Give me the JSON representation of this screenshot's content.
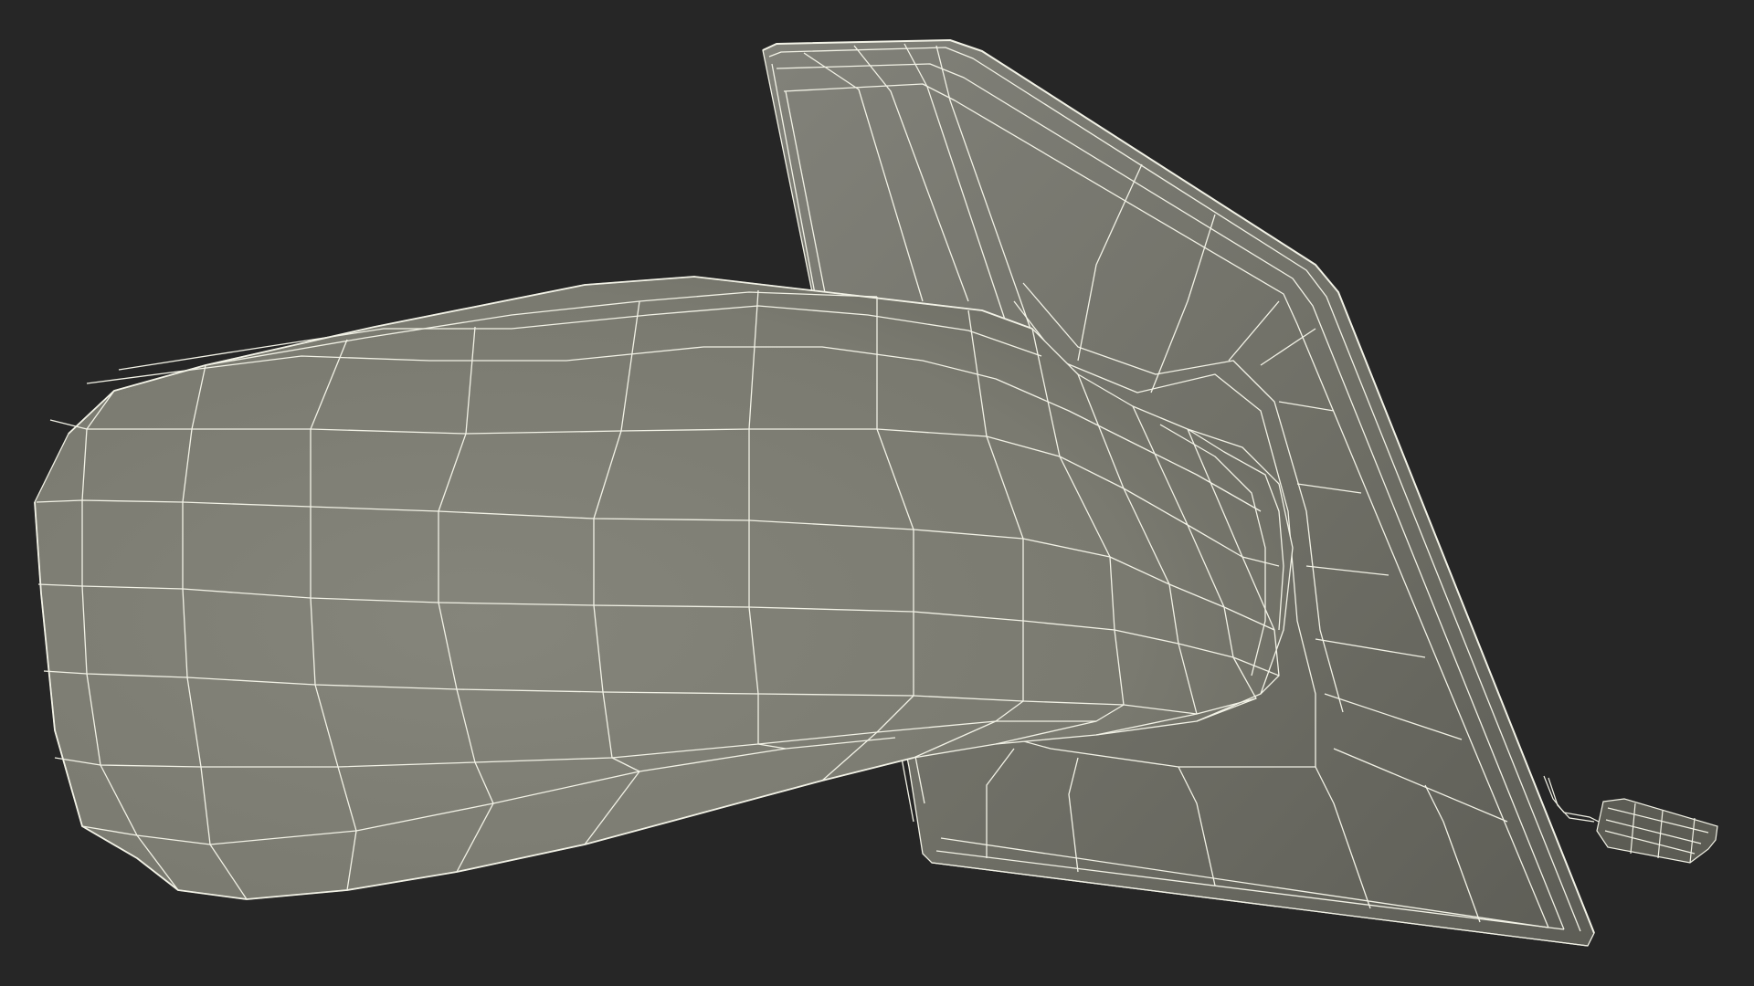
{
  "scene": {
    "subject": "car-side-mirror-wireframe",
    "colors": {
      "background": "#262626",
      "surface_light": "#84847a",
      "surface_mid": "#78786d",
      "surface_dark": "#606058",
      "wire": "#f2f2e6"
    }
  }
}
